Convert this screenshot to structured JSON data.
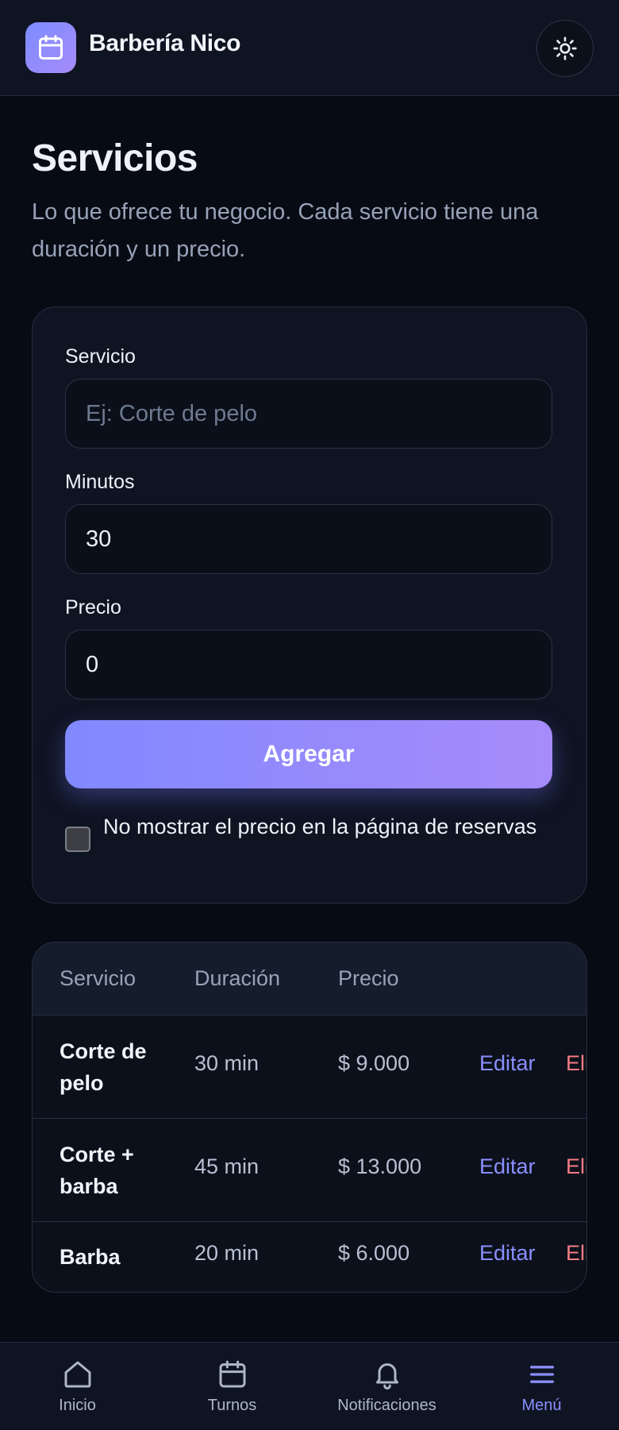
{
  "header": {
    "app_name": "Barbería Nico",
    "logo_icon": "calendar-icon",
    "theme_icon": "sun-icon"
  },
  "intro": {
    "title": "Servicios",
    "subtitle": "Lo que ofrece tu negocio. Cada servicio tiene una duración y un precio."
  },
  "form": {
    "service_label": "Servicio",
    "service_placeholder": "Ej: Corte de pelo",
    "service_value": "",
    "minutes_label": "Minutos",
    "minutes_value": "30",
    "price_label": "Precio",
    "price_value": "0",
    "add_button": "Agregar",
    "hide_price_label": "No mostrar el precio en la página de reservas",
    "hide_price_checked": false
  },
  "table": {
    "headers": [
      "Servicio",
      "Duración",
      "Precio"
    ],
    "rows": [
      {
        "service": "Corte de pelo",
        "duration": "30 min",
        "price": "$ 9.000",
        "edit": "Editar",
        "delete": "Eliminar"
      },
      {
        "service": "Corte + barba",
        "duration": "45 min",
        "price": "$ 13.000",
        "edit": "Editar",
        "delete": "Eliminar"
      },
      {
        "service": "Barba",
        "duration": "20 min",
        "price": "$ 6.000",
        "edit": "Editar",
        "delete": "Eliminar"
      }
    ]
  },
  "nav": {
    "items": [
      {
        "label": "Inicio",
        "icon": "home-icon",
        "active": false
      },
      {
        "label": "Turnos",
        "icon": "calendar-icon",
        "active": false
      },
      {
        "label": "Notificaciones",
        "icon": "bell-icon",
        "active": false
      },
      {
        "label": "Menú",
        "icon": "menu-icon",
        "active": true
      }
    ]
  },
  "colors": {
    "background": "#070b14",
    "surface": "#0e1422",
    "accent": "#8b8fff",
    "accent_gradient_end": "#a78bfa",
    "danger": "#f77c84",
    "muted_text": "#97a2b8"
  }
}
